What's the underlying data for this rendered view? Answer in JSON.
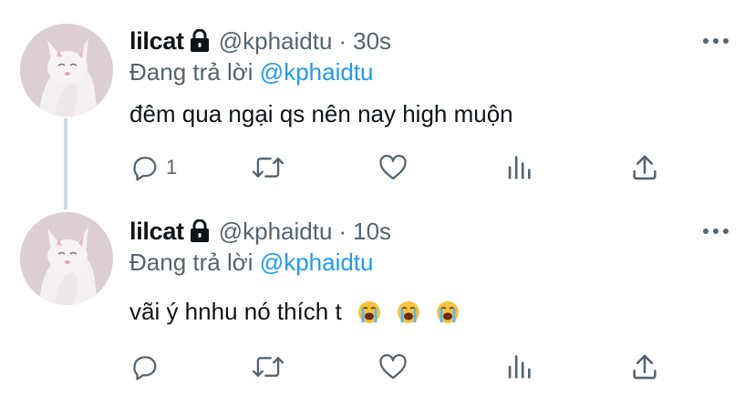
{
  "tweets": [
    {
      "name": "lilcat",
      "handle": "@kphaidtu",
      "separator": "·",
      "time": "30s",
      "replying_prefix": "Đang trả lời",
      "replying_to": "@kphaidtu",
      "text": "đêm qua ngại qs nên nay high muộn",
      "emojis": [],
      "reply_count": "1",
      "icons": [
        "reply-icon",
        "retweet-icon",
        "like-icon",
        "analytics-icon",
        "share-icon",
        "more-icon",
        "lock-icon"
      ]
    },
    {
      "name": "lilcat",
      "handle": "@kphaidtu",
      "separator": "·",
      "time": "10s",
      "replying_prefix": "Đang trả lời",
      "replying_to": "@kphaidtu",
      "text": "vãi ý hnhu nó thích t",
      "emojis": [
        "loudly-crying-face",
        "loudly-crying-face",
        "loudly-crying-face"
      ],
      "reply_count": "",
      "icons": [
        "reply-icon",
        "retweet-icon",
        "like-icon",
        "analytics-icon",
        "share-icon",
        "more-icon",
        "lock-icon"
      ]
    }
  ],
  "colors": {
    "text": "#0f1419",
    "secondary": "#536471",
    "mention": "#1d9bf0",
    "thread_line": "#cfd9de",
    "emoji_face": "#f7c23c"
  }
}
